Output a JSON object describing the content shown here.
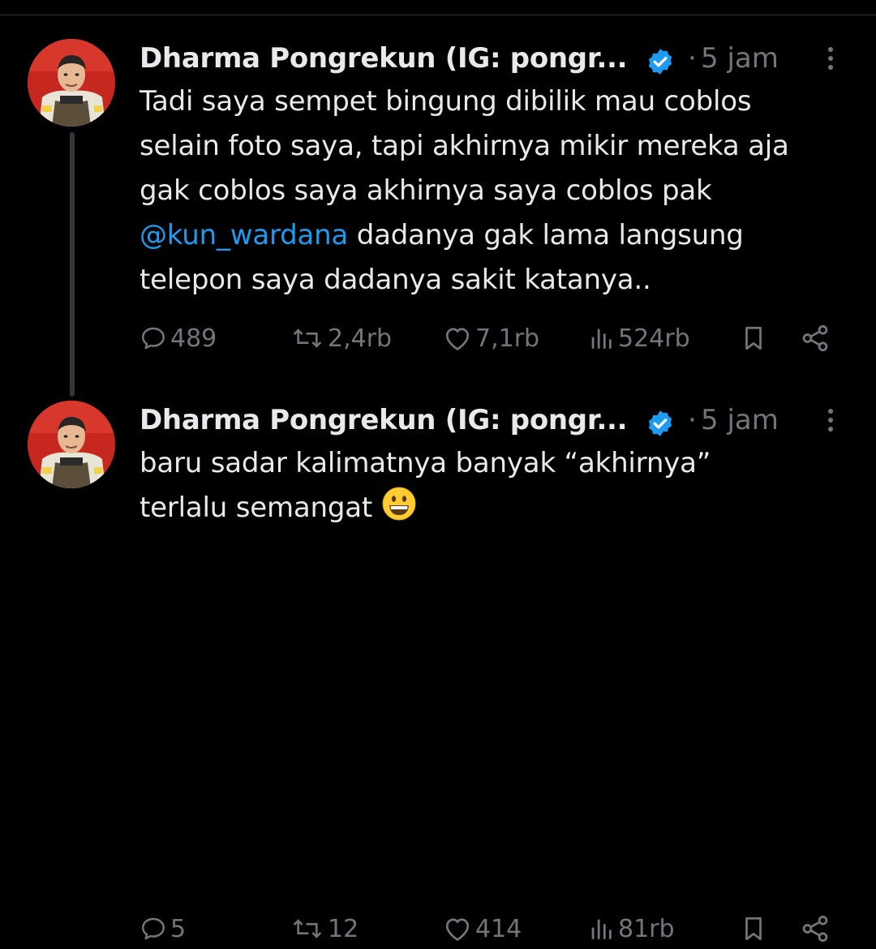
{
  "tweets": [
    {
      "author": "Dharma Pongrekun (IG: pongr...",
      "separator": "·",
      "time": "5 jam",
      "text_lines": [
        "Tadi saya sempet bingung dibilik mau coblos",
        "selain foto saya, tapi akhirnya mikir mereka aja",
        "gak coblos saya akhirnya saya coblos pak"
      ],
      "mention": "@kun_wardana",
      "mention_line_rest": " dadanya gak lama langsung",
      "last_line": "telepon saya dadanya sakit katanya..",
      "stats": {
        "replies": "489",
        "reposts": "2,4rb",
        "likes": "7,1rb",
        "views": "524rb"
      }
    },
    {
      "author": "Dharma Pongrekun (IG: pongr...",
      "separator": "·",
      "time": "5 jam",
      "text_lines": [
        "baru sadar kalimatnya banyak “akhirnya”",
        "terlalu semangat"
      ],
      "emoji": "grinning-face",
      "stats": {
        "replies": "5",
        "reposts": "12",
        "likes": "414",
        "views": "81rb"
      }
    }
  ],
  "colors": {
    "background": "#000000",
    "text": "#e7e9ea",
    "muted": "#71767b",
    "mention": "#1d9bf0",
    "verified": "#1d9bf0",
    "thread_line": "#333639"
  }
}
